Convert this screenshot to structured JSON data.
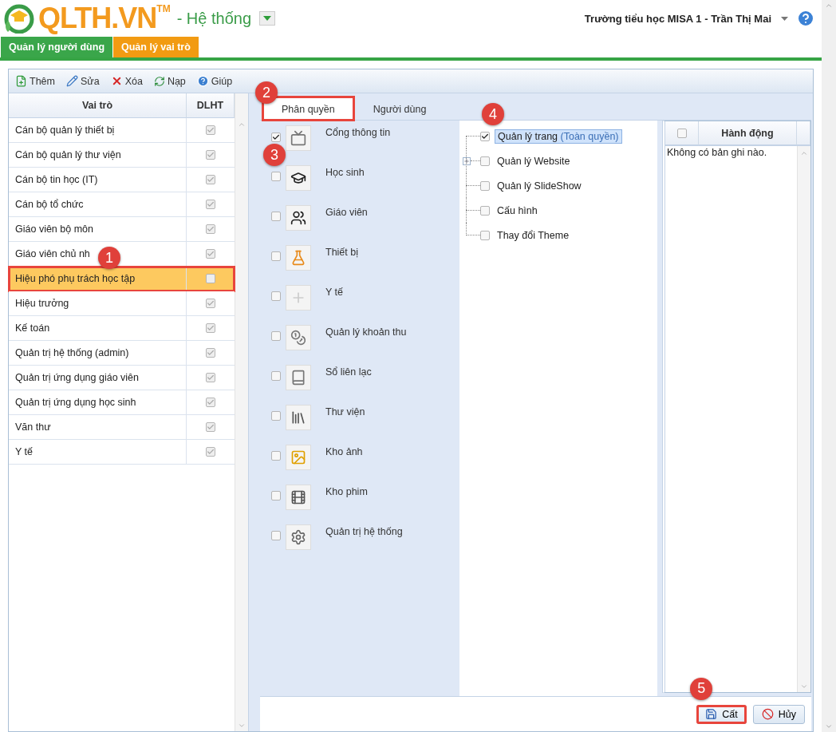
{
  "header": {
    "logo": "QLTH.VN",
    "trademark": "TM",
    "section": "- Hệ thống",
    "user": "Trường tiểu học MISA 1 - Trần Thị Mai"
  },
  "nav_tabs": [
    {
      "label": "Quản lý người dùng",
      "selected": false
    },
    {
      "label": "Quản lý vai trò",
      "selected": true
    }
  ],
  "toolbar": [
    "Thêm",
    "Sửa",
    "Xóa",
    "Nạp",
    "Giúp"
  ],
  "roles": {
    "columns": [
      "Vai trò",
      "DLHT"
    ],
    "rows": [
      {
        "name": "Cán bộ quản lý thiết bị",
        "checked": true,
        "selected": false
      },
      {
        "name": "Cán bộ quản lý thư viện",
        "checked": true,
        "selected": false
      },
      {
        "name": "Cán bộ tin học (IT)",
        "checked": true,
        "selected": false
      },
      {
        "name": "Cán bộ tổ chức",
        "checked": true,
        "selected": false
      },
      {
        "name": "Giáo viên bộ môn",
        "checked": true,
        "selected": false
      },
      {
        "name": "Giáo viên chủ nh",
        "checked": true,
        "selected": false,
        "callout": "1"
      },
      {
        "name": "Hiệu phó phụ trách học tập",
        "checked": false,
        "selected": true,
        "highlighted": true
      },
      {
        "name": "Hiệu trưởng",
        "checked": true,
        "selected": false
      },
      {
        "name": "Kế toán",
        "checked": true,
        "selected": false
      },
      {
        "name": "Quản trị hệ thống (admin)",
        "checked": true,
        "selected": false
      },
      {
        "name": "Quản trị ứng dụng giáo viên",
        "checked": true,
        "selected": false
      },
      {
        "name": "Quản trị ứng dụng học sinh",
        "checked": true,
        "selected": false
      },
      {
        "name": "Văn thư",
        "checked": true,
        "selected": false
      },
      {
        "name": "Y tế",
        "checked": true,
        "selected": false
      }
    ]
  },
  "detail_tabs": [
    {
      "label": "Phân quyền",
      "selected": true,
      "highlighted": true,
      "callout": "2"
    },
    {
      "label": "Người dùng",
      "selected": false,
      "highlighted": false
    }
  ],
  "modules": [
    {
      "label": "Cổng thông tin",
      "checked": true,
      "callout": "3"
    },
    {
      "label": "Học sinh",
      "checked": false
    },
    {
      "label": "Giáo viên",
      "checked": false
    },
    {
      "label": "Thiết bị",
      "checked": false
    },
    {
      "label": "Y tế",
      "checked": false
    },
    {
      "label": "Quản lý khoản thu",
      "checked": false
    },
    {
      "label": "Sổ liên lạc",
      "checked": false
    },
    {
      "label": "Thư viện",
      "checked": false
    },
    {
      "label": "Kho ảnh",
      "checked": false
    },
    {
      "label": "Kho phim",
      "checked": false
    },
    {
      "label": "Quản trị hệ thống",
      "checked": false
    }
  ],
  "functions": [
    {
      "label": "Quản lý trang",
      "note": "(Toàn quyền)",
      "checked": true,
      "selected": true,
      "expandable": false,
      "callout": "4"
    },
    {
      "label": "Quản lý Website",
      "checked": false,
      "selected": false,
      "expandable": true
    },
    {
      "label": "Quản lý SlideShow",
      "checked": false,
      "selected": false,
      "expandable": false
    },
    {
      "label": "Cấu hình",
      "checked": false,
      "selected": false,
      "expandable": false
    },
    {
      "label": "Thay đổi Theme",
      "checked": false,
      "selected": false,
      "expandable": false
    }
  ],
  "actions": {
    "column": "Hành động",
    "all_checked": false,
    "empty_message": "Không có bản ghi nào."
  },
  "footer_buttons": [
    {
      "kind": "save",
      "label": "Cất",
      "highlighted": true,
      "callout": "5"
    },
    {
      "kind": "cancel",
      "label": "Hủy",
      "highlighted": false
    }
  ]
}
